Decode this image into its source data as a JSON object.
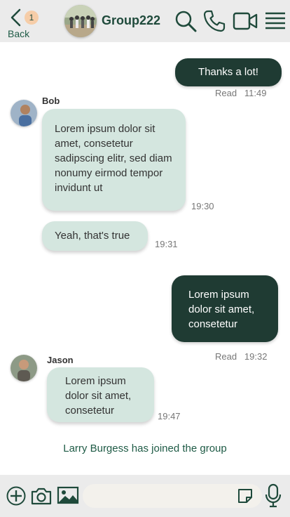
{
  "header": {
    "back_label": "Back",
    "unread_count": "1",
    "group_name": "Group222",
    "icons": [
      "chevron-left-icon",
      "search-icon",
      "phone-icon",
      "video-icon",
      "menu-icon"
    ]
  },
  "messages": [
    {
      "direction": "out",
      "text": "Thanks a lot!",
      "status": "Read",
      "time": "11:49"
    },
    {
      "direction": "in",
      "sender": "Bob",
      "text": "Lorem ipsum dolor sit amet, consetetur sadipscing elitr, sed diam nonumy eirmod tempor invidunt ut",
      "time": "19:30"
    },
    {
      "direction": "in",
      "sender": "Bob",
      "text": "Yeah, that's true",
      "time": "19:31"
    },
    {
      "direction": "out",
      "text": "Lorem ipsum dolor sit amet, consetetur",
      "status": "Read",
      "time": "19:32"
    },
    {
      "direction": "in",
      "sender": "Jason",
      "text": "Lorem ipsum dolor sit amet, consetetur",
      "time": "19:47"
    }
  ],
  "system_message": "Larry Burgess has joined the group",
  "composer": {
    "message_value": "",
    "icons": [
      "plus-icon",
      "camera-icon",
      "image-icon",
      "sticker-icon",
      "microphone-icon"
    ]
  },
  "colors": {
    "header_bg": "#ebebeb",
    "accent": "#1f4a3b",
    "outgoing_bubble": "#1f3b33",
    "incoming_bubble": "#d4e6df",
    "badge": "#f6cda8"
  }
}
